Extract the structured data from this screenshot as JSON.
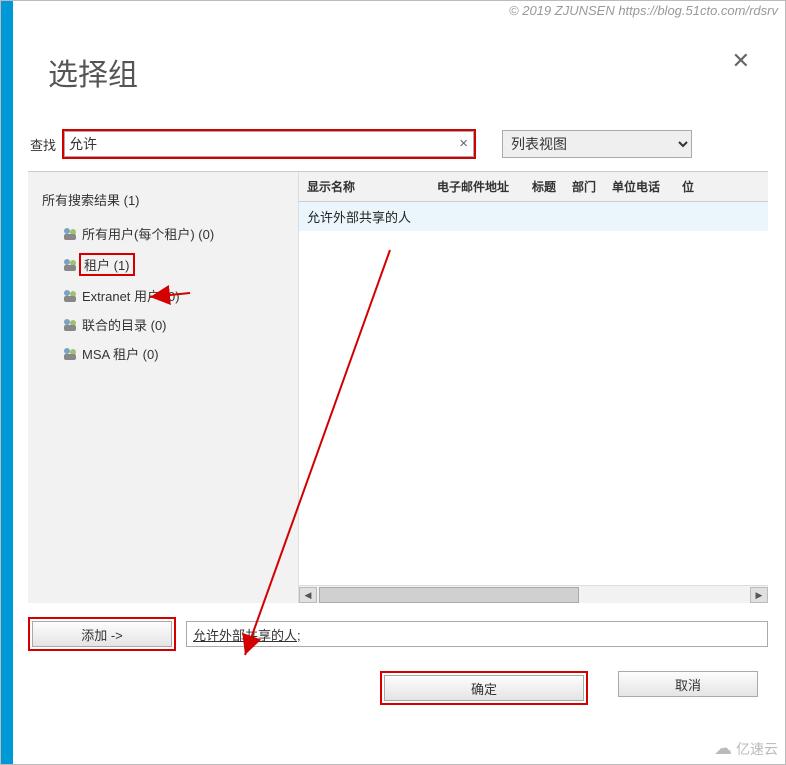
{
  "copyright": "© 2019 ZJUNSEN https://blog.51cto.com/rdsrv",
  "dialog": {
    "title": "选择组",
    "close_aria": "close"
  },
  "search": {
    "label": "查找",
    "value": "允许",
    "clear_icon": "×"
  },
  "view_select": {
    "selected": "列表视图"
  },
  "tree": {
    "root_label": "所有搜索结果 (1)",
    "items": [
      {
        "label": "所有用户(每个租户) (0)",
        "highlighted": false
      },
      {
        "label": "租户 (1)",
        "highlighted": true
      },
      {
        "label": "Extranet 用户 (0)",
        "highlighted": false
      },
      {
        "label": "联合的目录 (0)",
        "highlighted": false
      },
      {
        "label": "MSA 租户 (0)",
        "highlighted": false
      }
    ]
  },
  "table": {
    "headers": {
      "display_name": "显示名称",
      "email": "电子邮件地址",
      "title": "标题",
      "department": "部门",
      "phone": "单位电话",
      "last": "位"
    },
    "rows": [
      {
        "display_name": "允许外部共享的人"
      }
    ]
  },
  "add_button": {
    "label": "添加 ->"
  },
  "selected_text": {
    "value": "允许外部共享的人;"
  },
  "ok_button": {
    "label": "确定"
  },
  "cancel_button": {
    "label": "取消"
  },
  "watermark": "亿速云",
  "annotation_color": "#d40000"
}
